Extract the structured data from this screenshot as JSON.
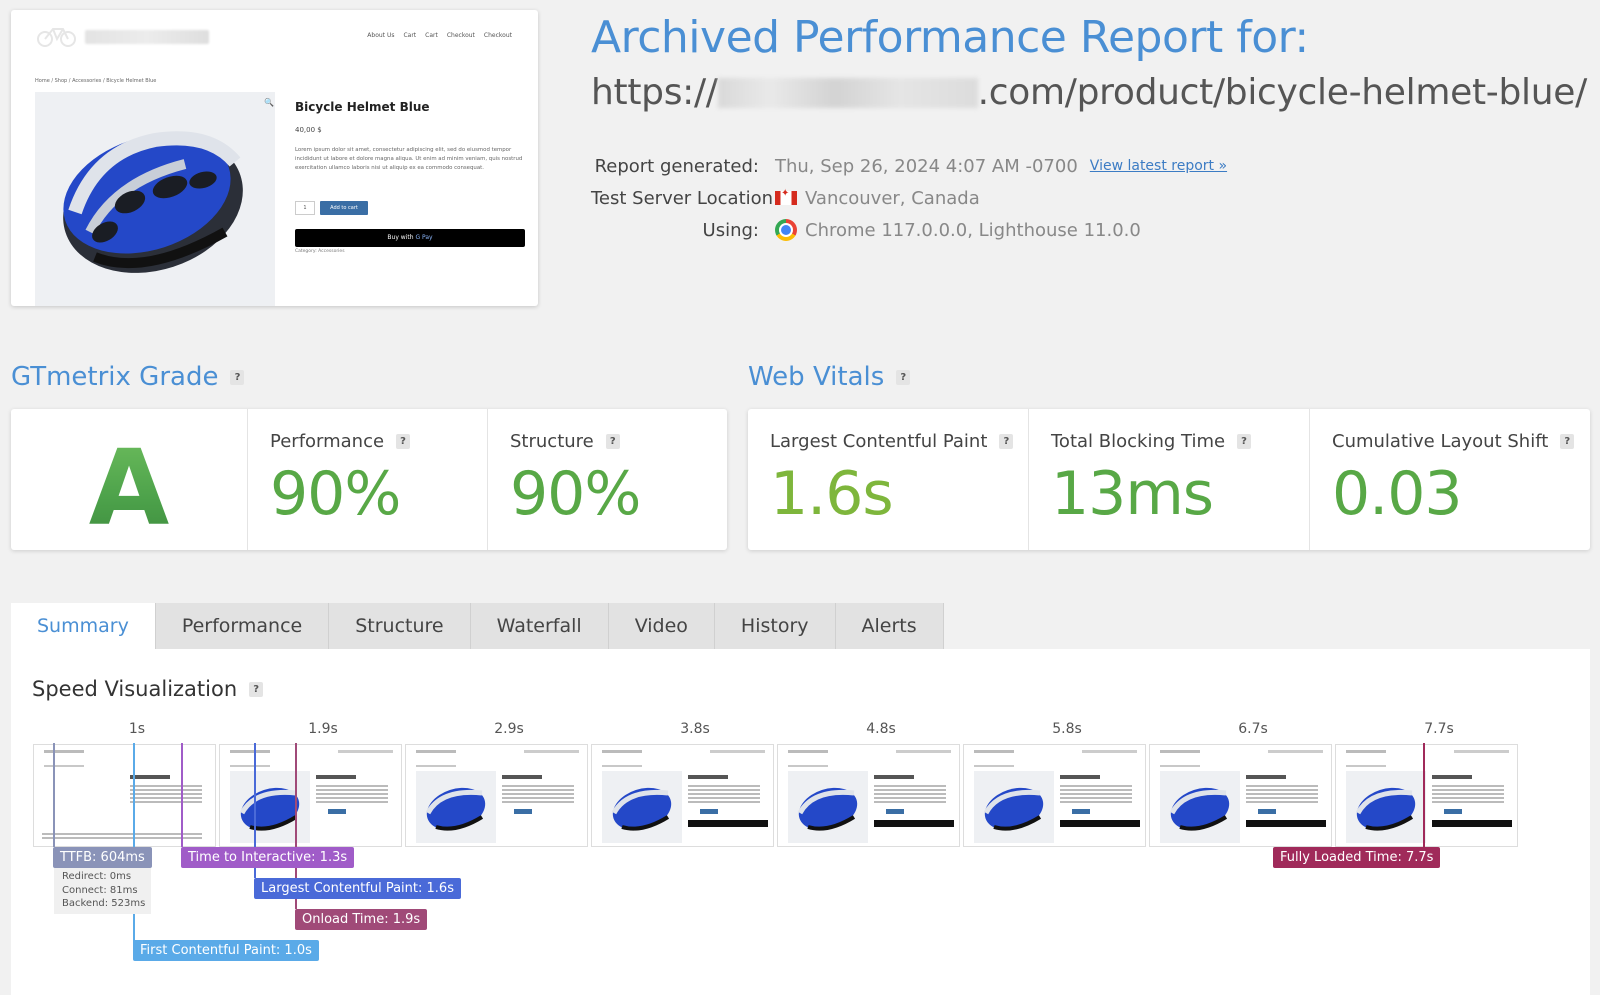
{
  "preview": {
    "nav": [
      "About Us",
      "Cart",
      "Cart",
      "Checkout",
      "Checkout"
    ],
    "breadcrumb": "Home / Shop / Accessories / Bicycle Helmet Blue",
    "product_title": "Bicycle Helmet Blue",
    "price": "40,00 $",
    "description": "Lorem ipsum dolor sit amet, consectetur adipiscing elit, sed do eiusmod tempor incididunt ut labore et dolore magna aliqua. Ut enim ad minim veniam, quis nostrud exercitation ullamco laboris nisi ut aliquip ex ea commodo consequat.",
    "qty": "1",
    "add_to_cart": "Add to cart",
    "buy_with": "Buy with",
    "gpay": "G Pay",
    "category": "Category: Accessories"
  },
  "report": {
    "title": "Archived Performance Report for:",
    "url_prefix": "https://",
    "url_suffix": ".com/product/bicycle-helmet-blue/",
    "generated_label": "Report generated:",
    "generated_value": "Thu, Sep 26, 2024 4:07 AM -0700",
    "view_latest": "View latest report »",
    "location_label": "Test Server Location:",
    "location_value": "Vancouver, Canada",
    "using_label": "Using:",
    "using_value": "Chrome 117.0.0.0, Lighthouse 11.0.0"
  },
  "grade": {
    "title": "GTmetrix Grade",
    "letter": "A",
    "performance_label": "Performance",
    "performance_value": "90%",
    "structure_label": "Structure",
    "structure_value": "90%"
  },
  "vitals": {
    "title": "Web Vitals",
    "lcp_label": "Largest Contentful Paint",
    "lcp_value": "1.6s",
    "tbt_label": "Total Blocking Time",
    "tbt_value": "13ms",
    "cls_label": "Cumulative Layout Shift",
    "cls_value": "0.03"
  },
  "help_glyph": "?",
  "tabs": [
    "Summary",
    "Performance",
    "Structure",
    "Waterfall",
    "Video",
    "History",
    "Alerts"
  ],
  "speed": {
    "title": "Speed Visualization",
    "frame_times": [
      "1s",
      "1.9s",
      "2.9s",
      "3.8s",
      "4.8s",
      "5.8s",
      "6.7s",
      "7.7s"
    ],
    "ttfb": "TTFB: 604ms",
    "ttfb_redirect": "Redirect: 0ms",
    "ttfb_connect": "Connect: 81ms",
    "ttfb_backend": "Backend: 523ms",
    "tti": "Time to Interactive: 1.3s",
    "lcp": "Largest Contentful Paint: 1.6s",
    "onload": "Onload Time: 1.9s",
    "fcp": "First Contentful Paint: 1.0s",
    "fully_loaded": "Fully Loaded Time: 7.7s"
  },
  "colors": {
    "accent_blue": "#4a8fd4",
    "grade_green": "#58a846",
    "ttfb": "#8a93b8",
    "tti": "#a05cc8",
    "lcp": "#4a6ad8",
    "onload": "#a04a78",
    "fcp": "#5aaae8",
    "fully_loaded": "#a02a5a"
  }
}
